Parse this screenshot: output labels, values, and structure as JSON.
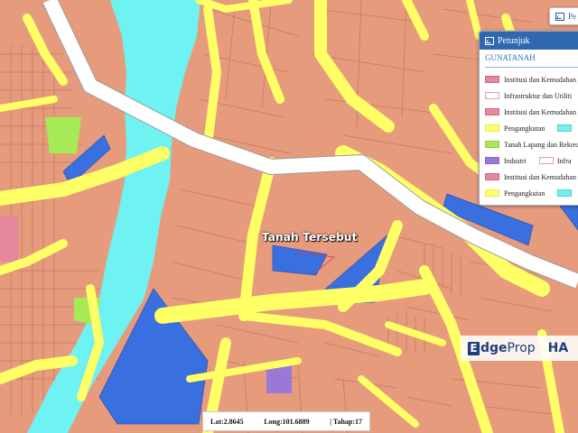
{
  "map": {
    "label": "Tanah Tersebut",
    "colors": {
      "residential": "#e79b7d",
      "road": "#ffff66",
      "water": "#6ef2f2",
      "institution": "#3a6fe0",
      "open_space": "#a6ea55",
      "industry": "#9a78d8",
      "infrastructure": "#ffffff",
      "parcel_line": "#c67a5e",
      "institution_pink": "#e7879b"
    }
  },
  "legend_button": {
    "label": "Pe",
    "icon": "map-legend-icon"
  },
  "legend": {
    "title": "Petunjuk",
    "section": "GUNATANAH",
    "items": [
      {
        "label": "Institusi dan Kemudahan M",
        "swatch": "#e7879b",
        "border": "#c96b7d"
      },
      {
        "label": "Infrastruktur dan Utiliti",
        "swatch": "#ffffff",
        "border": "#e0a0a8"
      },
      {
        "label": "Institusi dan Kemudahan M",
        "swatch": "#e7879b",
        "border": "#c96b7d"
      },
      {
        "label": "Pengangkutan",
        "swatch": "#ffff66",
        "border": "#e8e860",
        "swatch2": "#6ef2f2"
      },
      {
        "label": "Tanah Lapang dan Rekreas",
        "swatch": "#a6ea55",
        "border": "#8ccc44"
      },
      {
        "label": "Industri",
        "swatch": "#9a78d8",
        "border": "#8466c0",
        "swatch2": "#ffffff",
        "label2": "Infra"
      },
      {
        "label": "Institusi dan Kemudahan M",
        "swatch": "#e7879b",
        "border": "#c96b7d"
      },
      {
        "label": "Pengangkutan",
        "swatch": "#ffff66",
        "border": "#e8e860",
        "swatch2": "#6ef2f2"
      }
    ]
  },
  "watermark": {
    "e": "E",
    "dge": "dge",
    "prop": "Prop",
    "side": "HA"
  },
  "coords": {
    "lat": "Lat:2.8645",
    "long": "Long:101.6889",
    "tahap": "| Tahap:17"
  }
}
